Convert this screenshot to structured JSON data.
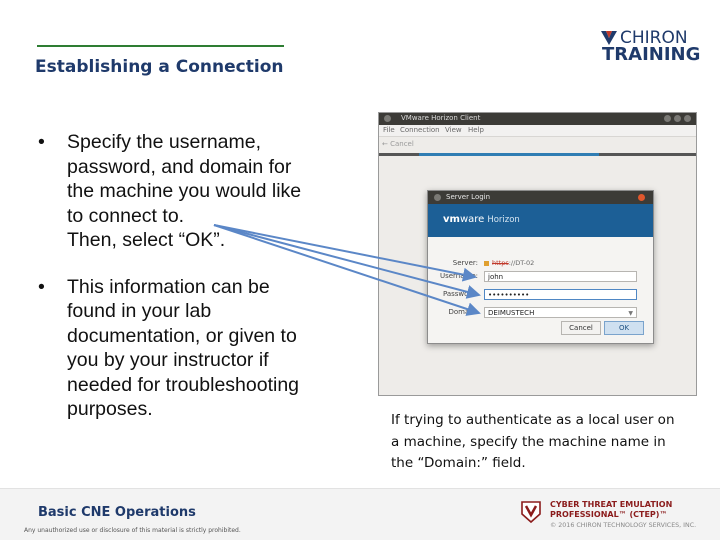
{
  "slide": {
    "title": "Establishing a Connection",
    "bullets": [
      {
        "lines": [
          "Specify the username,",
          "password, and domain for",
          "the machine you would like",
          "to connect to.",
          "Then, select “OK”."
        ]
      },
      {
        "lines": [
          "This information can be",
          "found in your lab",
          "documentation, or given to",
          "you by your instructor if",
          "needed for troubleshooting",
          "purposes."
        ]
      }
    ],
    "bullet_symbol": "•",
    "caption_lines": [
      "If trying to authenticate as a local user on",
      "a machine, specify the machine name in",
      "the “Domain:” field."
    ]
  },
  "logo": {
    "line1": "CHIRON",
    "line2": "TRAINING"
  },
  "screenshot": {
    "window_title": "VMware Horizon Client",
    "menu": [
      "File",
      "Connection",
      "View",
      "Help"
    ],
    "toolbar_cancel": "← Cancel",
    "dialog": {
      "title": "Server Login",
      "brand_vm": "vm",
      "brand_ware": "ware",
      "brand_product": "Horizon",
      "server_label": "Server:",
      "server_scheme": "https",
      "server_rest": "://DT-02",
      "username_label": "Username:",
      "username_value": "john",
      "password_label": "Password:",
      "password_value": "••••••••••",
      "domain_label": "Domain:",
      "domain_value": "DEIMUSTECH",
      "cancel_label": "Cancel",
      "ok_label": "OK"
    }
  },
  "footer": {
    "title": "Basic CNE Operations",
    "note": "Any unauthorized use or disclosure of this material is strictly prohibited.",
    "course_line1": "CYBER THREAT EMULATION",
    "course_line2": "PROFESSIONAL™ (CTEP)™",
    "copyright": "© 2016 CHIRON TECHNOLOGY SERVICES, INC."
  },
  "colors": {
    "title": "#1f3a6b",
    "accent_green": "#2e7d32",
    "arrow": "#5b87c7",
    "brand_red": "#8b1c1c",
    "horizon_blue": "#1c5f96"
  }
}
